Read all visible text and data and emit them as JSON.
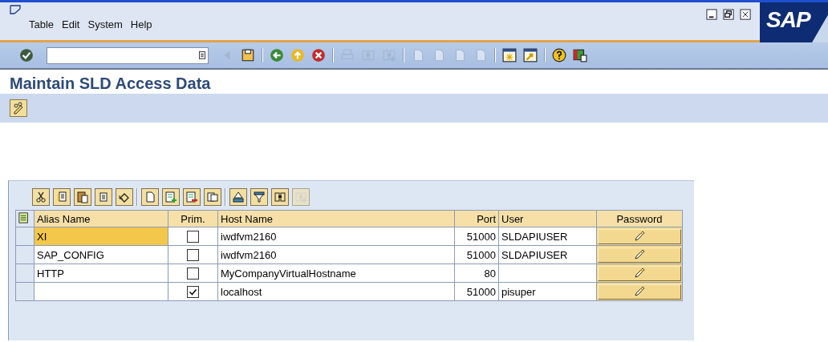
{
  "window": {
    "logo": "SAP",
    "controls": [
      {
        "kind": "minimize"
      },
      {
        "kind": "maximize"
      },
      {
        "kind": "close"
      }
    ]
  },
  "menu": [
    {
      "label": "Table"
    },
    {
      "label": "Edit"
    },
    {
      "label": "System"
    },
    {
      "label": "Help"
    }
  ],
  "toolbar": [
    {
      "kind": "enter",
      "disabled": false
    },
    {
      "kind": "command-field"
    },
    {
      "kind": "triangle-left",
      "disabled": true
    },
    {
      "kind": "save",
      "disabled": false
    },
    {
      "kind": "sep"
    },
    {
      "kind": "back",
      "disabled": false
    },
    {
      "kind": "exit",
      "disabled": false
    },
    {
      "kind": "cancel",
      "disabled": false
    },
    {
      "kind": "sep"
    },
    {
      "kind": "print",
      "disabled": true
    },
    {
      "kind": "find",
      "disabled": true
    },
    {
      "kind": "find-next",
      "disabled": true
    },
    {
      "kind": "sep"
    },
    {
      "kind": "page-first",
      "disabled": true
    },
    {
      "kind": "page-prev",
      "disabled": true
    },
    {
      "kind": "page-next",
      "disabled": true
    },
    {
      "kind": "page-last",
      "disabled": true
    },
    {
      "kind": "sep"
    },
    {
      "kind": "new-session",
      "disabled": false
    },
    {
      "kind": "shortcut",
      "disabled": false
    },
    {
      "kind": "sep"
    },
    {
      "kind": "help",
      "disabled": false
    },
    {
      "kind": "layout",
      "disabled": false
    }
  ],
  "title": "Maintain SLD Access Data",
  "app_toolbar": [
    {
      "kind": "display-change",
      "disabled": false
    }
  ],
  "table": {
    "toolbar": [
      {
        "kind": "cut",
        "disabled": false
      },
      {
        "kind": "copy",
        "disabled": false
      },
      {
        "kind": "paste",
        "disabled": false
      },
      {
        "kind": "paste-menu",
        "disabled": false
      },
      {
        "kind": "undo",
        "disabled": false
      },
      {
        "kind": "sep"
      },
      {
        "kind": "new-row",
        "disabled": false
      },
      {
        "kind": "insert-row",
        "disabled": false
      },
      {
        "kind": "delete-row",
        "disabled": false
      },
      {
        "kind": "copy-row",
        "disabled": false
      },
      {
        "kind": "sep"
      },
      {
        "kind": "sort",
        "disabled": false
      },
      {
        "kind": "filter",
        "disabled": false
      },
      {
        "kind": "find",
        "disabled": false
      },
      {
        "kind": "find-next",
        "disabled": true
      }
    ],
    "columns": [
      "Alias Name",
      "Prim.",
      "Host Name",
      "Port",
      "User",
      "Password"
    ],
    "rows": [
      {
        "alias": "XI",
        "alias_focused": true,
        "primary": false,
        "host": "iwdfvm2160",
        "port": "51000",
        "user": "SLDAPIUSER"
      },
      {
        "alias": "SAP_CONFIG",
        "alias_focused": false,
        "primary": false,
        "host": "iwdfvm2160",
        "port": "51000",
        "user": "SLDAPIUSER"
      },
      {
        "alias": "HTTP",
        "alias_focused": false,
        "primary": false,
        "host": "MyCompanyVirtualHostname",
        "port": "80",
        "user": ""
      },
      {
        "alias": "",
        "alias_focused": false,
        "primary": true,
        "host": "localhost",
        "port": "51000",
        "user": "pisuper"
      }
    ]
  }
}
